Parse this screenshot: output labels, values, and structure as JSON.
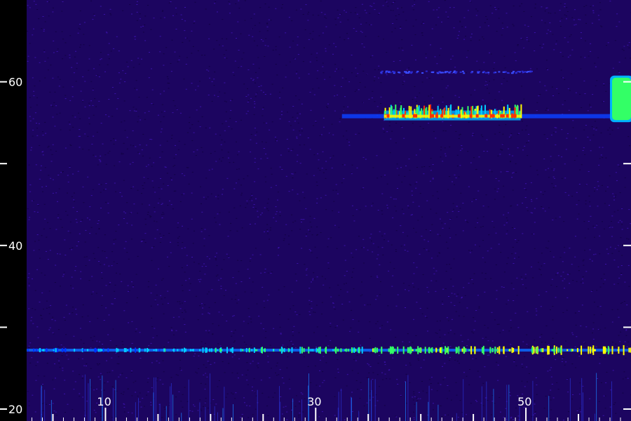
{
  "chart_data": {
    "type": "heatmap",
    "title": "",
    "xlabel": "",
    "ylabel": "",
    "xlim": [
      2.5,
      60
    ],
    "ylim": [
      20,
      70
    ],
    "x_ticks": [
      {
        "value": 10,
        "label": "10"
      },
      {
        "value": 30,
        "label": "30"
      },
      {
        "value": 50,
        "label": "50"
      }
    ],
    "x_minor_ticks": [
      5,
      15,
      20,
      25,
      35,
      40,
      45,
      55
    ],
    "y_ticks": [
      {
        "value": 20,
        "label": "20"
      },
      {
        "value": 40,
        "label": "40"
      },
      {
        "value": 60,
        "label": "60"
      }
    ],
    "y_minor_ticks": [
      30,
      50
    ],
    "colormap": [
      "#1e0066",
      "#2a0a9a",
      "#0033ff",
      "#00ccff",
      "#33ff66",
      "#ffff00",
      "#ff3300"
    ],
    "background_noise_color": "#24087a",
    "features": [
      {
        "name": "",
        "x_start": 32.5,
        "x_end": 59.5,
        "y": 55.8,
        "intensity": 0.8
      },
      {
        "name": "",
        "x_start": 2.5,
        "x_end": 60,
        "y": 27.2,
        "intensity": 0.45
      },
      {
        "name": "",
        "x_start": 58.2,
        "x_end": 60,
        "y_start": 55.5,
        "y_end": 60.5,
        "intensity": 0.7
      },
      {
        "name": "",
        "x_start": 36,
        "x_end": 50.5,
        "y": 61.3,
        "intensity": 0.25
      }
    ]
  }
}
